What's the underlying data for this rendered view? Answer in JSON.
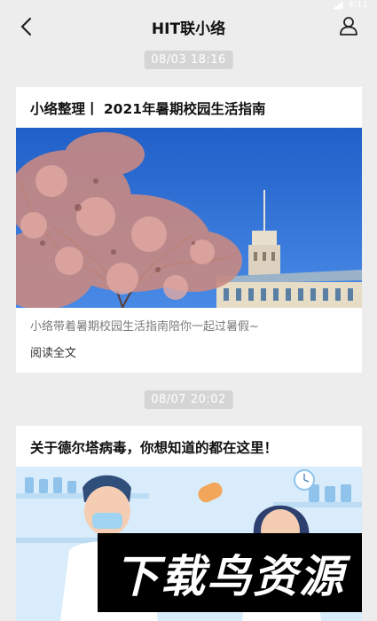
{
  "status_bar": {
    "time": "4:11"
  },
  "header": {
    "title": "HIT联小络"
  },
  "articles": [
    {
      "timestamp": "08/03 18:16",
      "title": "小络整理丨 2021年暑期校园生活指南",
      "summary": "小络带着暑期校园生活指南陪你一起过暑假~",
      "read_more": "阅读全文"
    },
    {
      "timestamp": "08/07 20:02",
      "title": "关于德尔塔病毒，你想知道的都在这里！"
    }
  ],
  "watermark": {
    "text": "下载鸟资源"
  },
  "colors": {
    "background": "#ededed",
    "sky": "#2f6fd6",
    "blossom": "#c7867f"
  }
}
